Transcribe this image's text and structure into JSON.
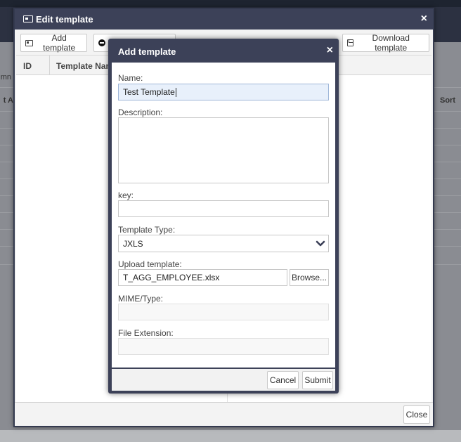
{
  "background": {
    "column_fragment": "mn",
    "all_fragment": "t Al",
    "sort_label": "Sort"
  },
  "edit_dialog": {
    "title": "Edit template",
    "close_glyph": "×",
    "toolbar": {
      "add_label": "Add template",
      "download_label": "Download template"
    },
    "grid": {
      "columns": [
        "ID",
        "Template Name"
      ]
    },
    "close_label": "Close"
  },
  "add_dialog": {
    "title": "Add template",
    "close_glyph": "×",
    "fields": {
      "name_label": "Name:",
      "name_value": "Test Template",
      "description_label": "Description:",
      "description_value": "",
      "key_label": "key:",
      "key_value": "",
      "type_label": "Template Type:",
      "type_value": "JXLS",
      "upload_label": "Upload template:",
      "upload_value": "T_AGG_EMPLOYEE.xlsx",
      "browse_label": "Browse...",
      "mime_label": "MIME/Type:",
      "mime_value": "",
      "ext_label": "File Extension:",
      "ext_value": ""
    },
    "cancel_label": "Cancel",
    "submit_label": "Submit"
  },
  "icons": {
    "title": "card-icon",
    "add": "card-icon",
    "remove": "minus-circle-icon",
    "download": "save-icon",
    "select": "chevron-down-icon"
  }
}
